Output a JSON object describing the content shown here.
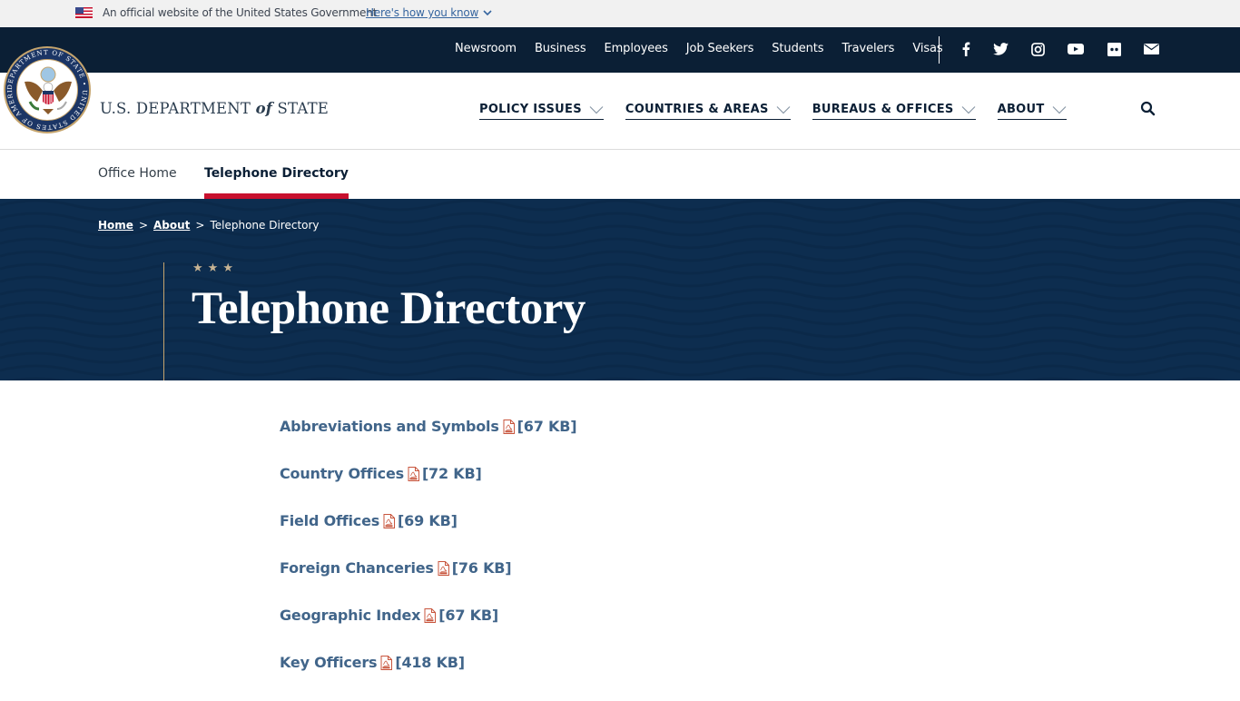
{
  "gov_banner": {
    "text": "An official website of the United States Government",
    "link": "Here's how you know"
  },
  "top_nav": {
    "links": [
      "Newsroom",
      "Business",
      "Employees",
      "Job Seekers",
      "Students",
      "Travelers",
      "Visas"
    ],
    "social": [
      "facebook-icon",
      "twitter-icon",
      "instagram-icon",
      "youtube-icon",
      "flickr-icon",
      "email-icon"
    ]
  },
  "brand": {
    "prefix": "U.S. DEPARTMENT ",
    "of": "of",
    "suffix": " STATE",
    "seal_alt": "Department of State Seal"
  },
  "main_nav": {
    "items": [
      "POLICY ISSUES",
      "COUNTRIES & AREAS",
      "BUREAUS & OFFICES",
      "ABOUT"
    ]
  },
  "sub_nav": {
    "tabs": [
      {
        "label": "Office Home",
        "active": false
      },
      {
        "label": "Telephone Directory",
        "active": true
      }
    ]
  },
  "breadcrumb": {
    "items": [
      "Home",
      "About"
    ],
    "current": "Telephone Directory",
    "separator": ">"
  },
  "hero": {
    "stars": "★ ★ ★",
    "title": "Telephone Directory"
  },
  "documents": [
    {
      "title": "Abbreviations and Symbols",
      "size": "[67 KB]",
      "type": "pdf"
    },
    {
      "title": "Country Offices",
      "size": "[72 KB]",
      "type": "pdf"
    },
    {
      "title": "Field Offices",
      "size": "[69 KB]",
      "type": "pdf"
    },
    {
      "title": "Foreign Chanceries",
      "size": "[76 KB]",
      "type": "pdf"
    },
    {
      "title": "Geographic Index",
      "size": "[67 KB]",
      "type": "pdf"
    },
    {
      "title": "Key Officers",
      "size": "[418 KB]",
      "type": "pdf"
    }
  ],
  "colors": {
    "navy": "#0b1f35",
    "hero_bg": "#0d2d4f",
    "accent_red": "#c8102e",
    "link_blue": "#41658a",
    "gold": "#c5a46d"
  }
}
